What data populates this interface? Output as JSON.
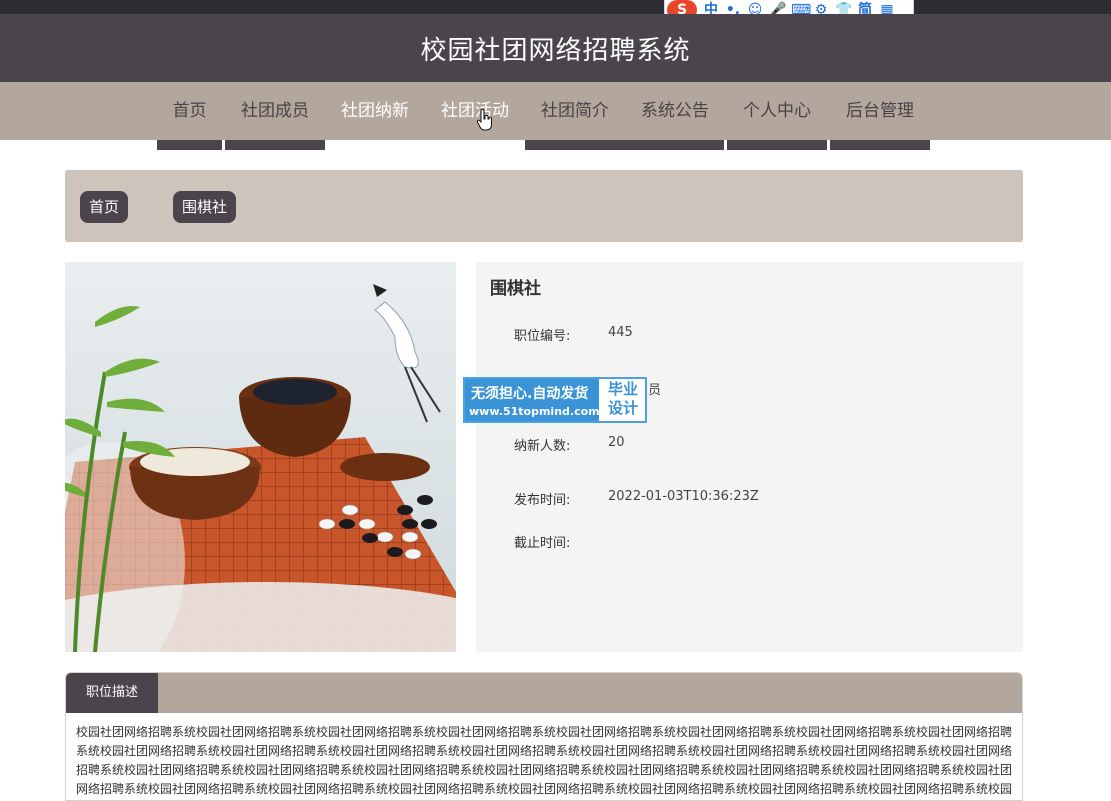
{
  "ime": {
    "logo": "S",
    "items": [
      "中",
      "•,",
      "☺",
      "🎤",
      "⌨",
      "⚙",
      "👕",
      "简",
      "▦"
    ]
  },
  "header": {
    "title": "校园社团网络招聘系统"
  },
  "nav": {
    "items": [
      {
        "label": "首页"
      },
      {
        "label": "社团成员"
      },
      {
        "label": "社团纳新"
      },
      {
        "label": "社团活动"
      },
      {
        "label": "社团简介"
      },
      {
        "label": "系统公告"
      },
      {
        "label": "个人中心"
      },
      {
        "label": "后台管理"
      }
    ]
  },
  "breadcrumb": {
    "home": "首页",
    "separator": "/",
    "current": "围棋社"
  },
  "detail": {
    "name": "围棋社",
    "fields": [
      {
        "label": "职位编号:",
        "value": "445"
      },
      {
        "label": "",
        "value": "员"
      },
      {
        "label": "纳新人数:",
        "value": "20"
      },
      {
        "label": "发布时间:",
        "value": "2022-01-03T10:36:23Z"
      },
      {
        "label": "截止时间:",
        "value": ""
      }
    ]
  },
  "watermark": {
    "line1": "无须担心.自动发货",
    "line2": "www.51topmind.com",
    "right1": "毕业",
    "right2": "设计"
  },
  "description": {
    "tab": "职位描述",
    "text": "校园社团网络招聘系统校园社团网络招聘系统校园社团网络招聘系统校园社团网络招聘系统校园社团网络招聘系统校园社团网络招聘系统校园社团网络招聘系统校园社团网络招聘系统校园社团网络招聘系统校园社团网络招聘系统校园社团网络招聘系统校园社团网络招聘系统校园社团网络招聘系统校园社团网络招聘系统校园社团网络招聘系统校园社团网络招聘系统校园社团网络招聘系统校园社团网络招聘系统校园社团网络招聘系统校园社团网络招聘系统校园社团网络招聘系统校园社团网络招聘系统校园社团网络招聘系统校园社团网络招聘系统校园社团网络招聘系统校园社团网络招聘系统校园社团网络招聘系统校园社团网络招聘系统校园社团网络招聘系统校园社团网络招聘系统校园社团网络招聘系统校园"
  }
}
